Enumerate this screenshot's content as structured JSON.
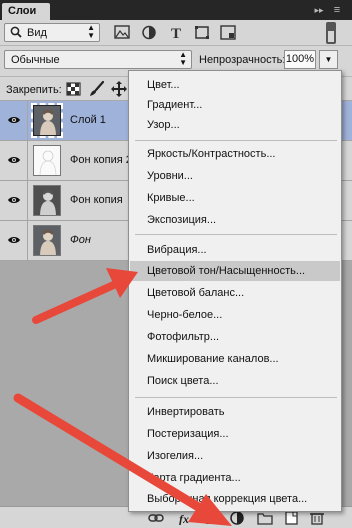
{
  "panel": {
    "tab_label": "Слои",
    "collapse_glyph": "▸▸",
    "menu_glyph": "≡"
  },
  "filter": {
    "label": "Вид",
    "icon": "search-icon"
  },
  "blend": {
    "mode": "Обычные",
    "opacity_label": "Непрозрачность:",
    "opacity_value": "100%"
  },
  "lock": {
    "label": "Закрепить:"
  },
  "layers": [
    {
      "name": "Слой 1",
      "selected": true,
      "italic": false,
      "thumb": "portrait"
    },
    {
      "name": "Фон копия 2",
      "selected": false,
      "italic": false,
      "thumb": "sketch"
    },
    {
      "name": "Фон копия",
      "selected": false,
      "italic": false,
      "thumb": "portrait"
    },
    {
      "name": "Фон",
      "selected": false,
      "italic": true,
      "thumb": "portrait"
    }
  ],
  "menu": {
    "groups": [
      [
        "Цвет...",
        "Градиент...",
        "Узор..."
      ],
      [
        "Яркость/Контрастность...",
        "Уровни...",
        "Кривые...",
        "Экспозиция..."
      ],
      [
        "Вибрация...",
        "Цветовой тон/Насыщенность...",
        "Цветовой баланс...",
        "Черно-белое...",
        "Фотофильтр...",
        "Микширование каналов...",
        "Поиск цвета..."
      ],
      [
        "Инвертировать",
        "Постеризация...",
        "Изогелия...",
        "Карта градиента...",
        "Выборочная коррекция цвета..."
      ]
    ],
    "highlighted": "Цветовой тон/Насыщенность..."
  },
  "bottom_bar": {
    "fx_label": "fx"
  },
  "colors": {
    "selected_row": "#9fb2d9",
    "arrow": "#e8483a",
    "menu_bg": "#f0f0f0",
    "header": "#262626"
  }
}
